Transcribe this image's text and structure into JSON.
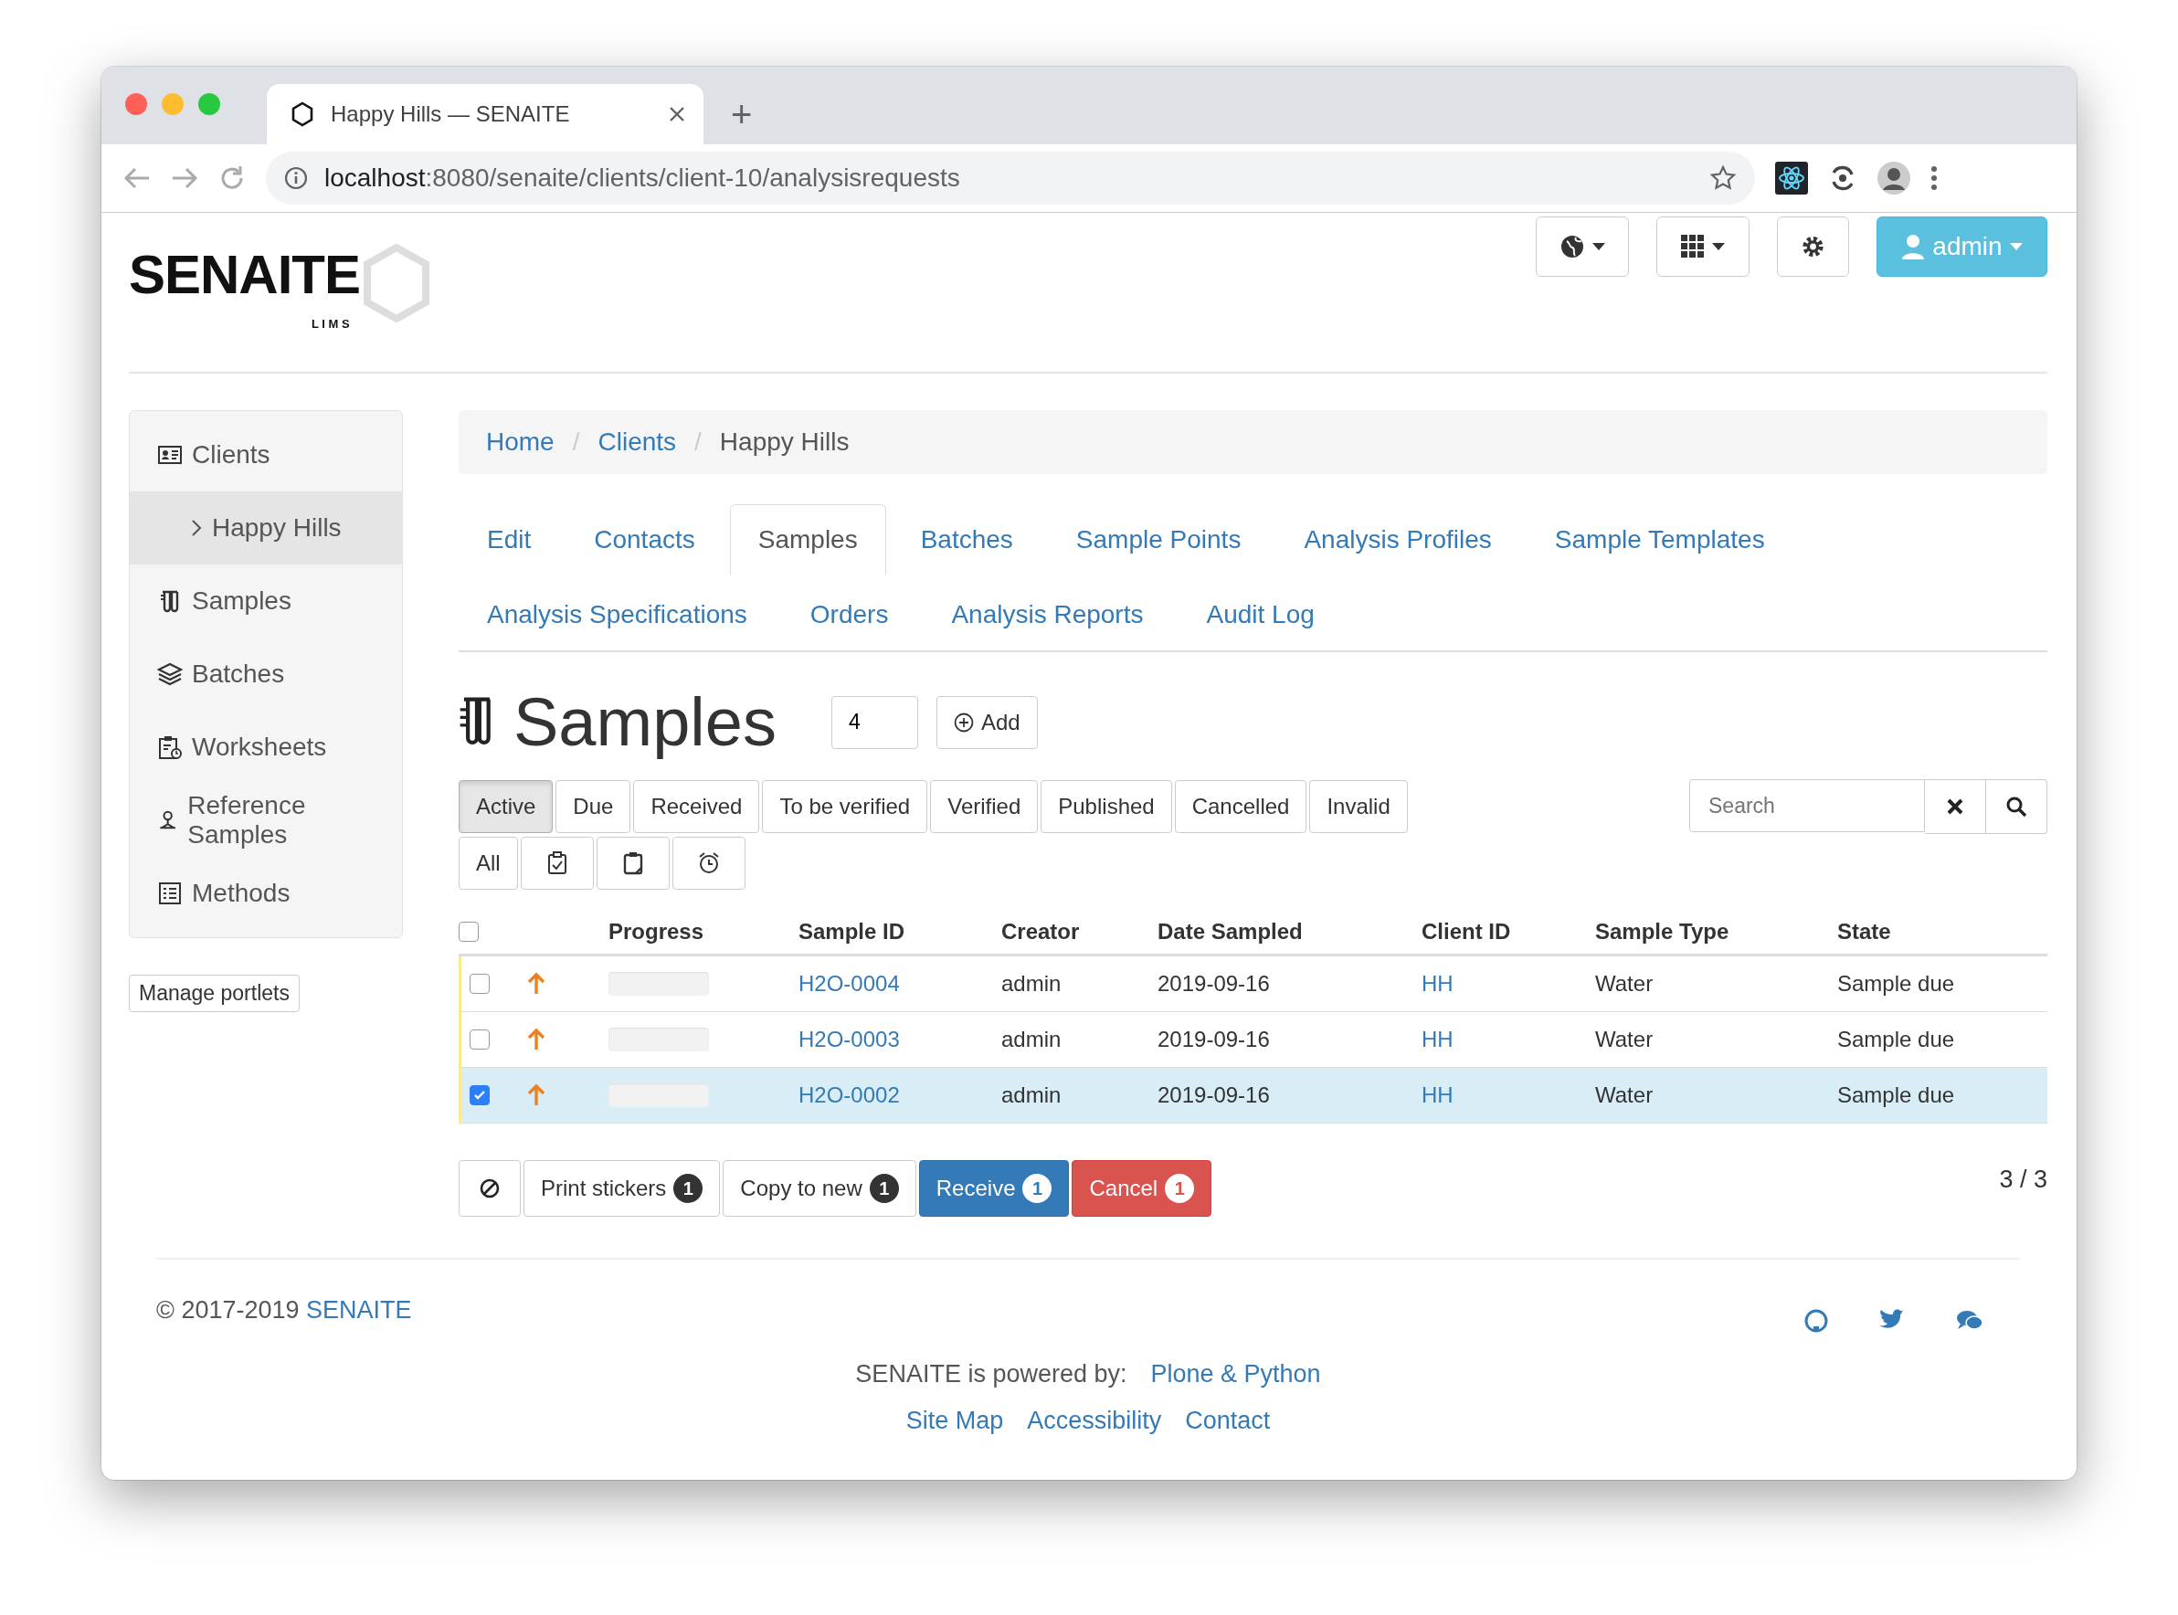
{
  "browser": {
    "tab_title": "Happy Hills — SENAITE",
    "new_tab": "+",
    "url_host": "localhost",
    "url_path": ":8080/senaite/clients/client-10/analysisrequests"
  },
  "header": {
    "logo": "SENAITE",
    "logo_sub": "L I M S",
    "user": "admin"
  },
  "sidebar": {
    "items": [
      {
        "label": "Clients",
        "selected": false,
        "children": [
          {
            "label": "Happy Hills",
            "selected": true
          }
        ]
      },
      {
        "label": "Samples",
        "selected": false
      },
      {
        "label": "Batches",
        "selected": false
      },
      {
        "label": "Worksheets",
        "selected": false
      },
      {
        "label": "Reference Samples",
        "selected": false
      },
      {
        "label": "Methods",
        "selected": false
      }
    ],
    "manage": "Manage portlets"
  },
  "breadcrumb_separator": "/",
  "breadcrumb": [
    {
      "label": "Home",
      "kind": "link"
    },
    {
      "label": "Clients",
      "kind": "link"
    },
    {
      "label": "Happy Hills",
      "kind": "current"
    }
  ],
  "tabs": [
    {
      "label": "Edit",
      "selected": false
    },
    {
      "label": "Contacts",
      "selected": false
    },
    {
      "label": "Samples",
      "selected": true
    },
    {
      "label": "Batches",
      "selected": false
    },
    {
      "label": "Sample Points",
      "selected": false
    },
    {
      "label": "Analysis Profiles",
      "selected": false
    },
    {
      "label": "Sample Templates",
      "selected": false
    },
    {
      "label": "Analysis Specifications",
      "selected": false
    },
    {
      "label": "Orders",
      "selected": false
    },
    {
      "label": "Analysis Reports",
      "selected": false
    },
    {
      "label": "Audit Log",
      "selected": false
    }
  ],
  "page": {
    "title": "Samples",
    "count_value": "4",
    "add": "Add"
  },
  "filters": [
    {
      "label": "Active",
      "selected": true
    },
    {
      "label": "Due",
      "selected": false
    },
    {
      "label": "Received",
      "selected": false
    },
    {
      "label": "To be verified",
      "selected": false
    },
    {
      "label": "Verified",
      "selected": false
    },
    {
      "label": "Published",
      "selected": false
    },
    {
      "label": "Cancelled",
      "selected": false
    },
    {
      "label": "Invalid",
      "selected": false
    }
  ],
  "filters_row_2": [
    {
      "kind": "text",
      "label": "All",
      "selected": false
    },
    {
      "kind": "icon",
      "selected": false
    },
    {
      "kind": "icon",
      "selected": false
    },
    {
      "kind": "icon",
      "selected": false
    }
  ],
  "search": {
    "placeholder": "Search"
  },
  "table": {
    "select_all": {
      "checked": false
    },
    "columns": [
      "Progress",
      "Sample ID",
      "Creator",
      "Date Sampled",
      "Client ID",
      "Sample Type",
      "State"
    ],
    "rows": [
      {
        "checked": false,
        "level": 0,
        "sample_id": "H2O-0004",
        "creator": "admin",
        "date_sampled": "2019-09-16",
        "client_id": "HH",
        "sample_type": "Water",
        "state": "Sample due"
      },
      {
        "checked": false,
        "level": 0,
        "sample_id": "H2O-0003",
        "creator": "admin",
        "date_sampled": "2019-09-16",
        "client_id": "HH",
        "sample_type": "Water",
        "state": "Sample due"
      },
      {
        "checked": true,
        "level": 0,
        "sample_id": "H2O-0002",
        "creator": "admin",
        "date_sampled": "2019-09-16",
        "client_id": "HH",
        "sample_type": "Water",
        "state": "Sample due"
      }
    ]
  },
  "actions": [
    {
      "kind": "icon"
    },
    {
      "kind": "default",
      "label": "Print stickers",
      "count": "1"
    },
    {
      "kind": "default",
      "label": "Copy to new",
      "count": "1"
    },
    {
      "kind": "primary",
      "label": "Receive",
      "count": "1"
    },
    {
      "kind": "danger",
      "label": "Cancel",
      "count": "1"
    }
  ],
  "pagination": "3 / 3",
  "footer": {
    "copyright": "© 2017-2019",
    "copyright_link": "SENAITE",
    "powered": "SENAITE is powered by:",
    "powered_link": "Plone & Python",
    "links": [
      "Site Map",
      "Accessibility",
      "Contact"
    ]
  }
}
